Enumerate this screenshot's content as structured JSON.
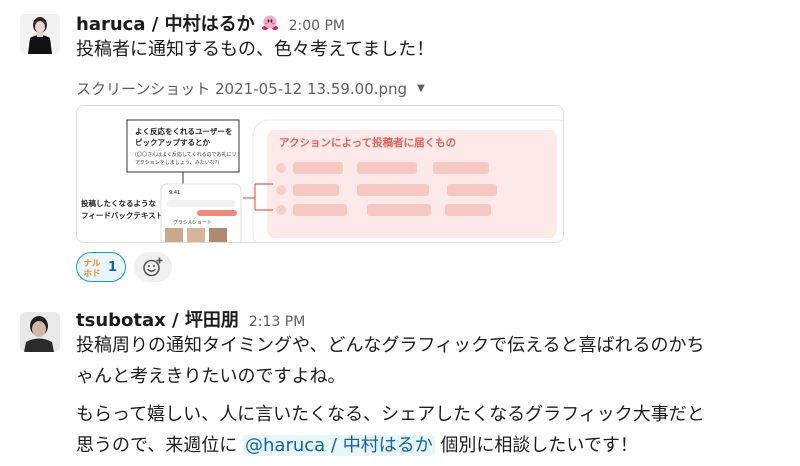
{
  "messages": [
    {
      "author": "haruca / 中村はるか",
      "time": "2:00 PM",
      "status_emoji": "kirby-emoji",
      "text": "投稿者に通知するもの、色々考えてました！",
      "file": {
        "name": "スクリーンショット 2021-05-12 13.59.00.png",
        "preview": {
          "box_text": [
            "よく反応をくれるユーザーを",
            "ピックアップするとか",
            "(〇〇さんはよく反応してくれるのでお礼にリ",
            "アクションをしましょう、みたいな?)"
          ],
          "side_text": [
            "投稿したくなるような",
            "フィードバックテキスト"
          ],
          "phone_time": "9:41",
          "tags": [
            "グラシル",
            "ショート"
          ],
          "panel_title": "アクションによって投稿者に届くもの"
        }
      },
      "reactions": [
        {
          "emoji_text": [
            "ナル",
            "ホド"
          ],
          "count": "1"
        }
      ],
      "add_reaction_icon": "add-reaction-icon"
    },
    {
      "author": "tsubotax / 坪田朋",
      "time": "2:13 PM",
      "lines": [
        "投稿周りの通知タイミングや、どんなグラフィックで伝えると喜ばれるのかち",
        "ゃんと考えきりたいのですよね。"
      ],
      "line3": "もらって嬉しい、人に言いたくなる、シェアしたくなるグラフィック大事だと",
      "line4_prefix": "思うので、来週位に ",
      "mention": "@haruca / 中村はるか",
      "line4_suffix": " 個別に相談したいです！"
    }
  ],
  "colors": {
    "link": "#1264a3",
    "mention_bg": "#e8f5fa",
    "panel_accent": "#e8615a"
  }
}
